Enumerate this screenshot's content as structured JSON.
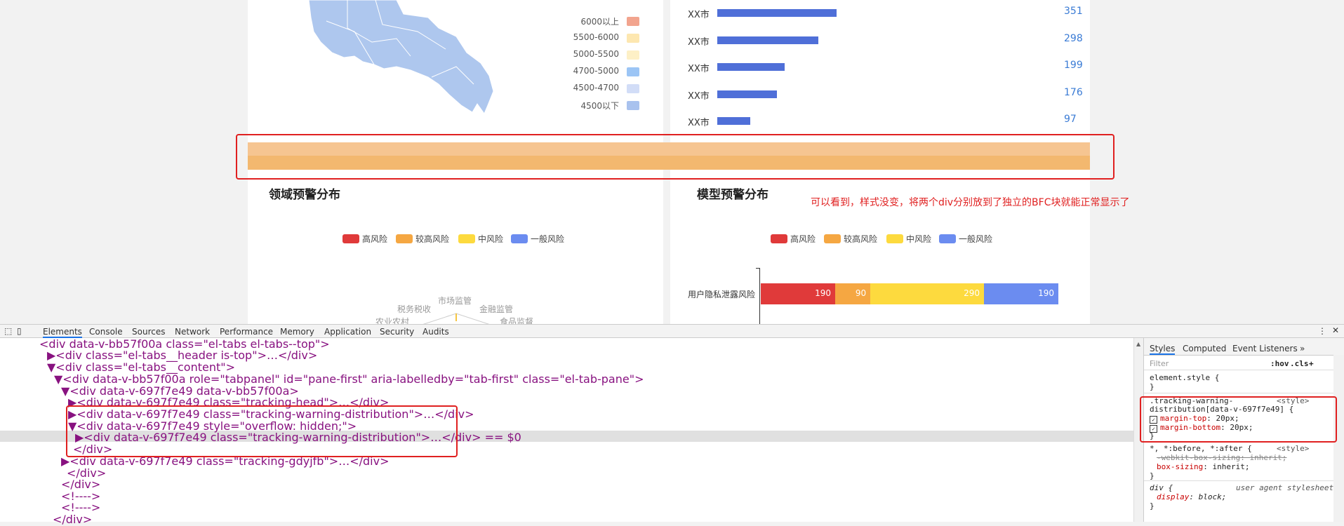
{
  "map_legend": [
    {
      "label": "6000以上",
      "color": "#f2a48e"
    },
    {
      "label": "5500-6000",
      "color": "#fde7b0"
    },
    {
      "label": "5000-5500",
      "color": "#fdf0c6"
    },
    {
      "label": "4700-5000",
      "color": "#9cc5f5"
    },
    {
      "label": "4500-4700",
      "color": "#d2ddf7"
    },
    {
      "label": "4500以下",
      "color": "#a9c2ee"
    }
  ],
  "chart_data": [
    {
      "type": "bar",
      "categories": [
        "XX市",
        "XX市",
        "XX市",
        "XX市",
        "XX市"
      ],
      "values": [
        351,
        298,
        199,
        176,
        97
      ]
    },
    {
      "type": "bar",
      "categories": [
        "用户隐私泄露风险"
      ],
      "series": [
        {
          "name": "高风险",
          "values": [
            190
          ]
        },
        {
          "name": "较高风险",
          "values": [
            90
          ]
        },
        {
          "name": "中风险",
          "values": [
            290
          ]
        },
        {
          "name": "一般风险",
          "values": [
            190
          ]
        }
      ]
    }
  ],
  "risk_colors": [
    "#e03a3a",
    "#f5a742",
    "#fdda3e",
    "#6b8cf0"
  ],
  "left_section_title": "领域预警分布",
  "right_section_title": "模型预警分布",
  "note": "可以看到，样式没变，将两个div分别放到了独立的BFC块就能正常显示了",
  "risk_legend": [
    "高风险",
    "较高风险",
    "中风险",
    "一般风险"
  ],
  "radar_labels": [
    "市场监管",
    "税务税收",
    "金融监管",
    "农业农村",
    "食品监督"
  ],
  "devtools": {
    "tabs": [
      "Elements",
      "Console",
      "Sources",
      "Network",
      "Performance",
      "Memory",
      "Application",
      "Security",
      "Audits"
    ],
    "dom_lines": [
      "<div data-v-bb57f00a class=\"el-tabs el-tabs--top\">",
      "▶<div class=\"el-tabs__header is-top\">…</div>",
      "▼<div class=\"el-tabs__content\">",
      "▼<div data-v-bb57f00a role=\"tabpanel\" id=\"pane-first\" aria-labelledby=\"tab-first\" class=\"el-tab-pane\">",
      "▼<div data-v-697f7e49 data-v-bb57f00a>",
      "▶<div data-v-697f7e49 class=\"tracking-head\">…</div>",
      "▶<div data-v-697f7e49 class=\"tracking-warning-distribution\">…</div>",
      "▼<div data-v-697f7e49 style=\"overflow: hidden;\">",
      "▶<div data-v-697f7e49 class=\"tracking-warning-distribution\">…</div> == $0",
      "</div>",
      "▶<div data-v-697f7e49 class=\"tracking-gdyjfb\">…</div>",
      "</div>",
      "</div>",
      "<!---->",
      "<!---->",
      "</div>"
    ],
    "styles_tabs": [
      "Styles",
      "Computed",
      "Event Listeners",
      "»"
    ],
    "filter_placeholder": "Filter",
    "hov": ":hov",
    "cls": ".cls",
    "plus": "+",
    "element_style": "element.style {",
    "brace_close": "}",
    "rule1_selector_a": ".tracking-warning-",
    "rule1_selector_b": "distribution[data-v-697f7e49] {",
    "rule1_source": "<style>",
    "rule1_prop1": "margin-top",
    "rule1_val1": "20px;",
    "rule1_prop2": "margin-bottom",
    "rule1_val2": "20px;",
    "rule2_selector": "*, *:before, *:after {",
    "rule2_source": "<style>",
    "rule2_prop1": "-webkit-box-sizing: inherit;",
    "rule2_prop2": "box-sizing",
    "rule2_val2": "inherit;",
    "rule3_selector": "div {",
    "rule3_source": "user agent stylesheet",
    "rule3_prop": "display",
    "rule3_val": "block;"
  }
}
